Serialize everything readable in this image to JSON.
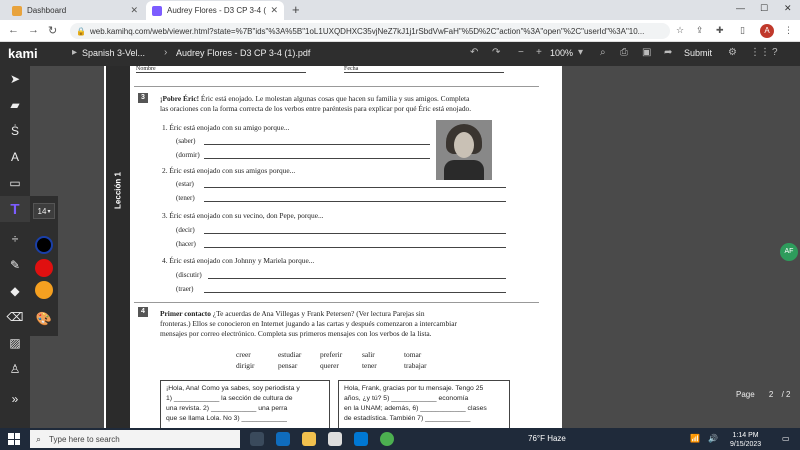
{
  "browser": {
    "tabs": [
      {
        "title": "Dashboard",
        "active": false,
        "favicon_color": "#e8a33d"
      },
      {
        "title": "Audrey Flores - D3 CP 3-4 (1).pdf",
        "active": true,
        "favicon_color": "#7c5cff"
      }
    ],
    "new_tab": "+",
    "url": "web.kamihq.com/web/viewer.html?state=%7B\"ids\"%3A%5B\"1oL1UXQDHXC35vjNeZ7kJ1j1rSbdVwFaH\"%5D%2C\"action\"%3A\"open\"%2C\"userId\"%3A\"10...",
    "profile_initial": "A"
  },
  "kami": {
    "logo": "kami",
    "breadcrumb_folder": "Spanish 3-Vel...",
    "breadcrumb_file": "Audrey Flores - D3 CP 3-4 (1).pdf",
    "zoom_level": "100%",
    "submit_label": "Submit",
    "user_initials": "AF",
    "font_size": "14",
    "swatches": [
      "#000000",
      "#e01010",
      "#f5a020"
    ],
    "page_label": "Page",
    "page_current": "2",
    "page_total": "/ 2"
  },
  "worksheet": {
    "nombre": "Nombre",
    "fecha": "Fecha",
    "leccion": "Lección 1",
    "ex3": {
      "number": "3",
      "title": "¡Pobre Éric!",
      "instructions_line1": "Éric está enojado. Le molestan algunas cosas que hacen su familia y sus amigos. Completa",
      "instructions_line2": "las oraciones con la forma correcta de los verbos entre paréntesis para explicar por qué Éric está enojado.",
      "items": [
        {
          "prompt": "1.  Éric está enojado con su amigo porque...",
          "verbs": [
            "(saber)",
            "(dormir)"
          ]
        },
        {
          "prompt": "2.  Éric está enojado con sus amigos porque...",
          "verbs": [
            "(estar)",
            "(tener)"
          ]
        },
        {
          "prompt": "3.  Éric está enojado con su vecino, don Pepe, porque...",
          "verbs": [
            "(decir)",
            "(hacer)"
          ]
        },
        {
          "prompt": "4.  Éric está enojado con Johnny y Mariela porque...",
          "verbs": [
            "(discutir)",
            "(traer)"
          ]
        }
      ]
    },
    "ex4": {
      "number": "4",
      "title": "Primer contacto",
      "line1": "¿Te acuerdas de Ana Villegas y Frank Petersen? (Ver lectura Parejas sin",
      "line2": "fronteras.) Ellos se conocieron en Internet jugando a las cartas y después comenzaron a intercambiar",
      "line3": "mensajes por correo electrónico. Completa sus primeros mensajes con los verbos de la lista.",
      "verb_row1": [
        "creer",
        "estudiar",
        "preferir",
        "salir",
        "tomar"
      ],
      "verb_row2": [
        "dirigir",
        "pensar",
        "querer",
        "tener",
        "trabajar"
      ],
      "msg_ana": [
        "¡Hola, Ana! Como ya sabes, soy periodista y",
        "1) ____________ la sección de cultura de",
        "una revista. 2) ____________ una perra",
        "que se llama Lola. No 3) ____________"
      ],
      "msg_frank": [
        "Hola, Frank, gracias por tu mensaje. Tengo 25",
        "años, ¿y tú? 5) ____________ economía",
        "en la UNAM; además, 6) ____________ clases",
        "de estadística. También 7) ____________"
      ]
    }
  },
  "taskbar": {
    "search_placeholder": "Type here to search",
    "weather": "76°F  Haze",
    "time": "1:14 PM",
    "date": "9/15/2023"
  }
}
